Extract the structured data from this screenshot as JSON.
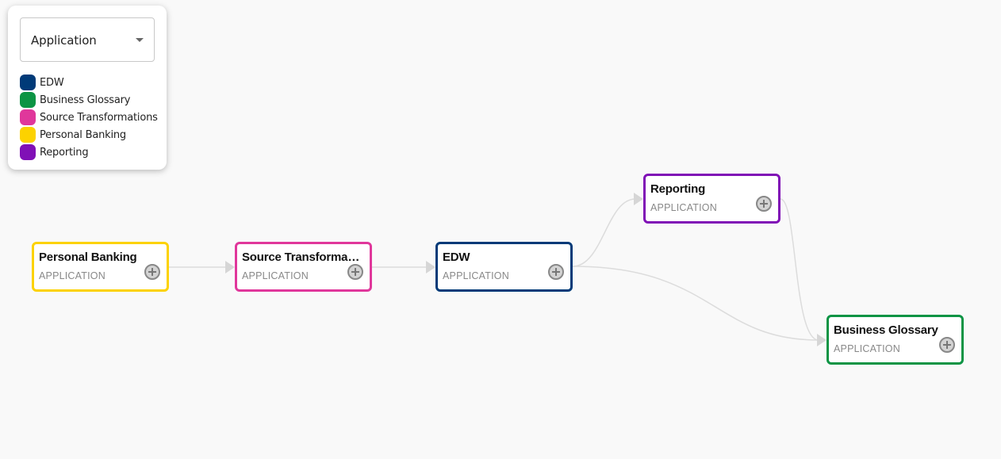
{
  "filter": {
    "selected": "Application"
  },
  "legend": [
    {
      "label": "EDW",
      "color": "#003a78"
    },
    {
      "label": "Business Glossary",
      "color": "#0c9444"
    },
    {
      "label": "Source Transformations",
      "color": "#e0379b"
    },
    {
      "label": "Personal Banking",
      "color": "#fcd200"
    },
    {
      "label": "Reporting",
      "color": "#8010b6"
    }
  ],
  "nodes": {
    "personal_banking": {
      "title": "Personal Banking",
      "type": "APPLICATION",
      "color": "#fcd200"
    },
    "source_transformations": {
      "title": "Source Transformations",
      "type": "APPLICATION",
      "color": "#e0379b"
    },
    "edw": {
      "title": "EDW",
      "type": "APPLICATION",
      "color": "#003a78"
    },
    "reporting": {
      "title": "Reporting",
      "type": "APPLICATION",
      "color": "#8010b6"
    },
    "business_glossary": {
      "title": "Business Glossary",
      "type": "APPLICATION",
      "color": "#0c9444"
    }
  },
  "edges": [
    {
      "from": "personal_banking",
      "to": "source_transformations"
    },
    {
      "from": "source_transformations",
      "to": "edw"
    },
    {
      "from": "edw",
      "to": "reporting"
    },
    {
      "from": "edw",
      "to": "business_glossary"
    },
    {
      "from": "reporting",
      "to": "business_glossary"
    }
  ]
}
